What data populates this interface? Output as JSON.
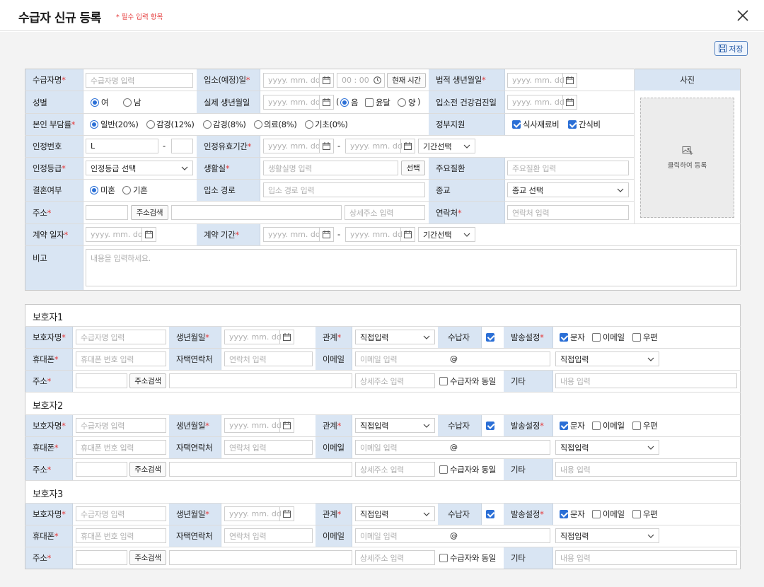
{
  "header": {
    "title": "수급자 신규 등록",
    "required_note": "* 필수 입력 항목"
  },
  "toolbar": {
    "save_label": "저장"
  },
  "labels": {
    "name": "수급자명",
    "admission": "입소(예정)일",
    "legal_birth": "법적 생년월일",
    "photo": "사진",
    "gender": "성별",
    "actual_birth": "실제 생년월일",
    "health_check": "입소전 건강검진일",
    "burden": "본인 부담률",
    "gov": "정부지원",
    "cert_no": "인정번호",
    "cert_period": "인정유효기간",
    "grade": "인정등급",
    "room": "생활실",
    "disease": "주요질환",
    "marriage": "결혼여부",
    "route": "입소 경로",
    "religion": "종교",
    "address": "주소",
    "contact": "연락처",
    "contract_date": "계약 일자",
    "contract_period": "계약 기간",
    "note": "비고"
  },
  "placeholders": {
    "name": "수급자명 입력",
    "date": "yyyy. mm. dd",
    "time": "00 : 00",
    "room": "생활실명 입력",
    "disease": "주요질환 입력",
    "route": "입소 경로 입력",
    "addr_detail": "상세주소 입력",
    "contact": "연락처 입력",
    "note": "내용을 입력하세요."
  },
  "buttons": {
    "now_time": "현재 시간",
    "room_select": "선택",
    "addr_search": "주소검색"
  },
  "options": {
    "gender_f": "여",
    "gender_m": "남",
    "lunar": "음",
    "leap": "윤달",
    "solar": "양",
    "b1": "일반(20%)",
    "b2": "감경(12%)",
    "b3": "감경(8%)",
    "b4": "의료(8%)",
    "b5": "기초(0%)",
    "gov1": "식사재료비",
    "gov2": "간식비",
    "married_no": "미혼",
    "married_yes": "기혼"
  },
  "values": {
    "cert_no": "L",
    "dash": "-",
    "period_select": "기간선택",
    "grade_select": "인정등급 선택",
    "religion_select": "종교 선택",
    "photo_text": "클릭하여 등록"
  },
  "guardian_labels": {
    "name": "보호자명",
    "birth": "생년월일",
    "relation": "관계",
    "payer": "수납자",
    "send": "발송설정",
    "phone": "휴대폰",
    "home": "자택연락처",
    "email": "이메일",
    "address": "주소",
    "etc": "기타"
  },
  "guardian_ph": {
    "name": "수급자명 입력",
    "birth": "yyyy. mm. dd",
    "phone": "휴대폰 번호 입력",
    "home": "연락처 입력",
    "email": "이메일 입력",
    "at": "@",
    "addr_detail": "상세주소 입력",
    "etc": "내용 입력"
  },
  "guardian_opts": {
    "relation": "직접입력",
    "email_domain": "직접입력",
    "sms": "문자",
    "mail": "이메일",
    "post": "우편",
    "same": "수급자와 동일",
    "addr_search": "주소검색"
  },
  "guardians": [
    {
      "title": "보호자1"
    },
    {
      "title": "보호자2"
    },
    {
      "title": "보호자3"
    }
  ]
}
